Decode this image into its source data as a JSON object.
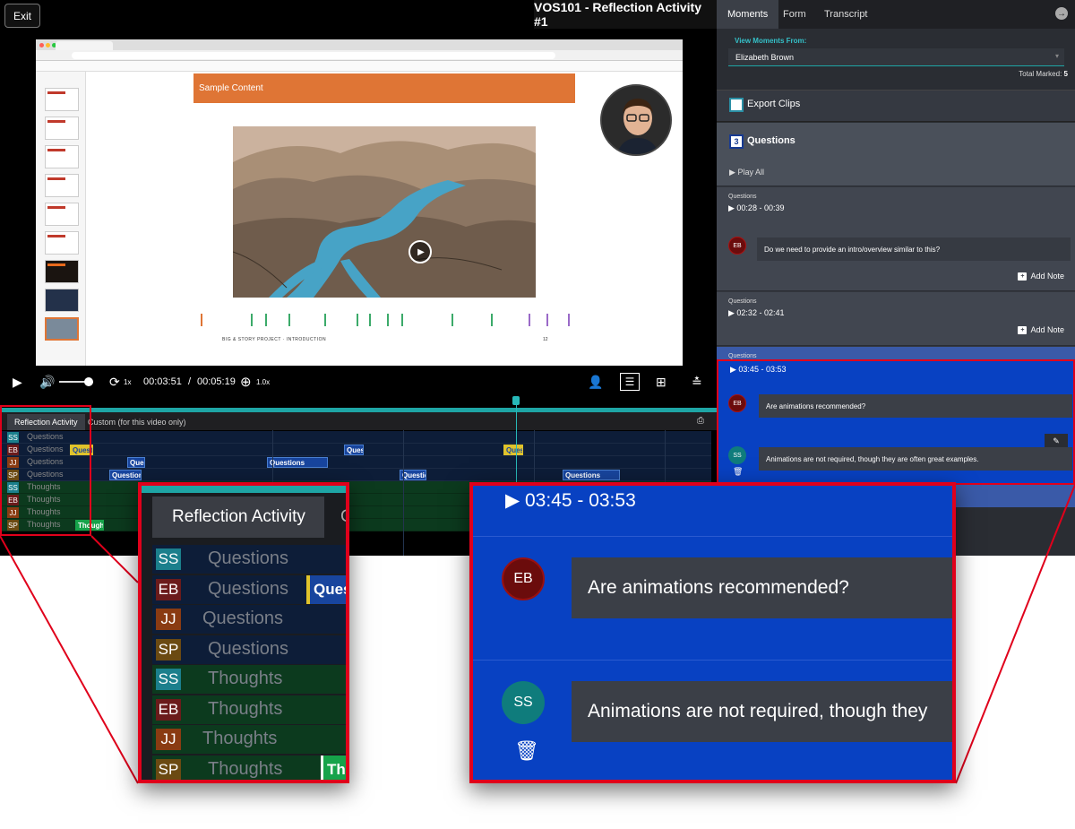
{
  "player": {
    "exit_label": "Exit",
    "course_title": "VOS101 - Reflection Activity #1",
    "slide_title": "Sample Content",
    "slide_footer": "BIG & STORY PROJECT · INTRODUCTION",
    "slide_number": "12",
    "controls": {
      "speed": "1x",
      "current_time": "00:03:51",
      "separator": "/",
      "duration": "00:05:19",
      "zoom": "1.0x"
    }
  },
  "timeline": {
    "tabs": [
      "Reflection Activity",
      "Custom (for this video only)"
    ],
    "rows": [
      {
        "initials": "SS",
        "label": "Questions",
        "color": "#1b7f8c",
        "type": "q"
      },
      {
        "initials": "EB",
        "label": "Questions",
        "color": "#6b1b1b",
        "type": "q"
      },
      {
        "initials": "JJ",
        "label": "Questions",
        "color": "#8a3b12",
        "type": "q"
      },
      {
        "initials": "SP",
        "label": "Questions",
        "color": "#6b4a12",
        "type": "q"
      },
      {
        "initials": "SS",
        "label": "Thoughts",
        "color": "#1b7f8c",
        "type": "t"
      },
      {
        "initials": "EB",
        "label": "Thoughts",
        "color": "#6b1b1b",
        "type": "t"
      },
      {
        "initials": "JJ",
        "label": "Thoughts",
        "color": "#8a3b12",
        "type": "t"
      },
      {
        "initials": "SP",
        "label": "Thoughts",
        "color": "#6b4a12",
        "type": "t"
      }
    ],
    "clip_label_q": "Quest",
    "clip_label_q_full": "Questions",
    "clip_label_t": "Thought",
    "zoom_clip_q": "Quest",
    "zoom_clip_t": "Tho"
  },
  "panel": {
    "tabs": [
      "Moments",
      "Form",
      "Transcript"
    ],
    "view_moments_label": "View Moments From:",
    "selected_user": "Elizabeth Brown",
    "total_marked_label": "Total Marked:",
    "total_marked_value": "5",
    "export_label": "Export Clips",
    "question_count": "3",
    "questions_title": "Questions",
    "play_all": "Play All",
    "add_note": "Add Note",
    "entries": [
      {
        "label": "Questions",
        "time": "00:28 - 00:39",
        "notes": [
          {
            "initials": "EB",
            "text": "Do we need to provide an intro/overview similar to this?"
          }
        ]
      },
      {
        "label": "Questions",
        "time": "02:32 - 02:41",
        "notes": []
      },
      {
        "label": "Questions",
        "time": "03:45 - 03:53",
        "notes": [
          {
            "initials": "EB",
            "text": "Are animations recommended?"
          },
          {
            "initials": "SS",
            "text": "Animations are not required, though they are often great examples."
          }
        ]
      }
    ]
  },
  "zoom_right": {
    "time": "03:45 - 03:53",
    "note1_initials": "EB",
    "note1": "Are animations recommended?",
    "note2_initials": "SS",
    "note2": "Animations are not required, though they"
  },
  "colors": {
    "accent_teal": "#1ea5a5",
    "highlight_blue": "#0841c2",
    "callout_red": "#e0001b",
    "slide_orange": "#df7535"
  }
}
